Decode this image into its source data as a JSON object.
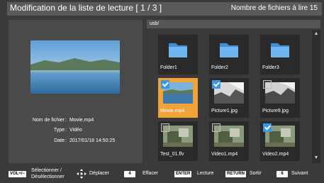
{
  "title": "Modification de la liste de lecture [ 1 / 3 ]",
  "file_count": "Nombre de fichiers à lire 15",
  "path": "usb/",
  "info": {
    "name_label": "Nom de fichier",
    "name_value": "Movie.mp4",
    "type_label": "Type",
    "type_value": "Vidéo",
    "date_label": "Date",
    "date_value": "2017/01/18 14:50:25"
  },
  "tiles": [
    {
      "label": "Folder1",
      "kind": "folder",
      "checked": false,
      "selected": false
    },
    {
      "label": "Folder2",
      "kind": "folder",
      "checked": false,
      "selected": false
    },
    {
      "label": "Folder3",
      "kind": "folder",
      "checked": false,
      "selected": false
    },
    {
      "label": "Movie.mp4",
      "kind": "movie",
      "checked": true,
      "selected": true
    },
    {
      "label": "Picture1.jpg",
      "kind": "bw",
      "checked": true,
      "selected": false
    },
    {
      "label": "Picture9.jpg",
      "kind": "bw",
      "checked": false,
      "selected": false
    },
    {
      "label": "Test_01.flv",
      "kind": "photo",
      "checked": false,
      "selected": false
    },
    {
      "label": "Video1.mp4",
      "kind": "photo",
      "checked": false,
      "selected": false
    },
    {
      "label": "Video2.mp4",
      "kind": "photo",
      "checked": true,
      "selected": false
    }
  ],
  "footer": {
    "vol_key": "VOL+/−",
    "select_label_1": "Sélectionner /",
    "select_label_2": "Désélectionner",
    "move_label": "Déplacer",
    "key_4": "4",
    "delete_label": "Effacer",
    "enter_key": "ENTER",
    "play_label": "Lecture",
    "return_key": "RETURN",
    "exit_label": "Sortir",
    "key_6": "6",
    "next_label": "Suivant"
  },
  "colors": {
    "accent": "#f1a338",
    "check": "#3a96e6",
    "background": "#3a3a3a"
  }
}
